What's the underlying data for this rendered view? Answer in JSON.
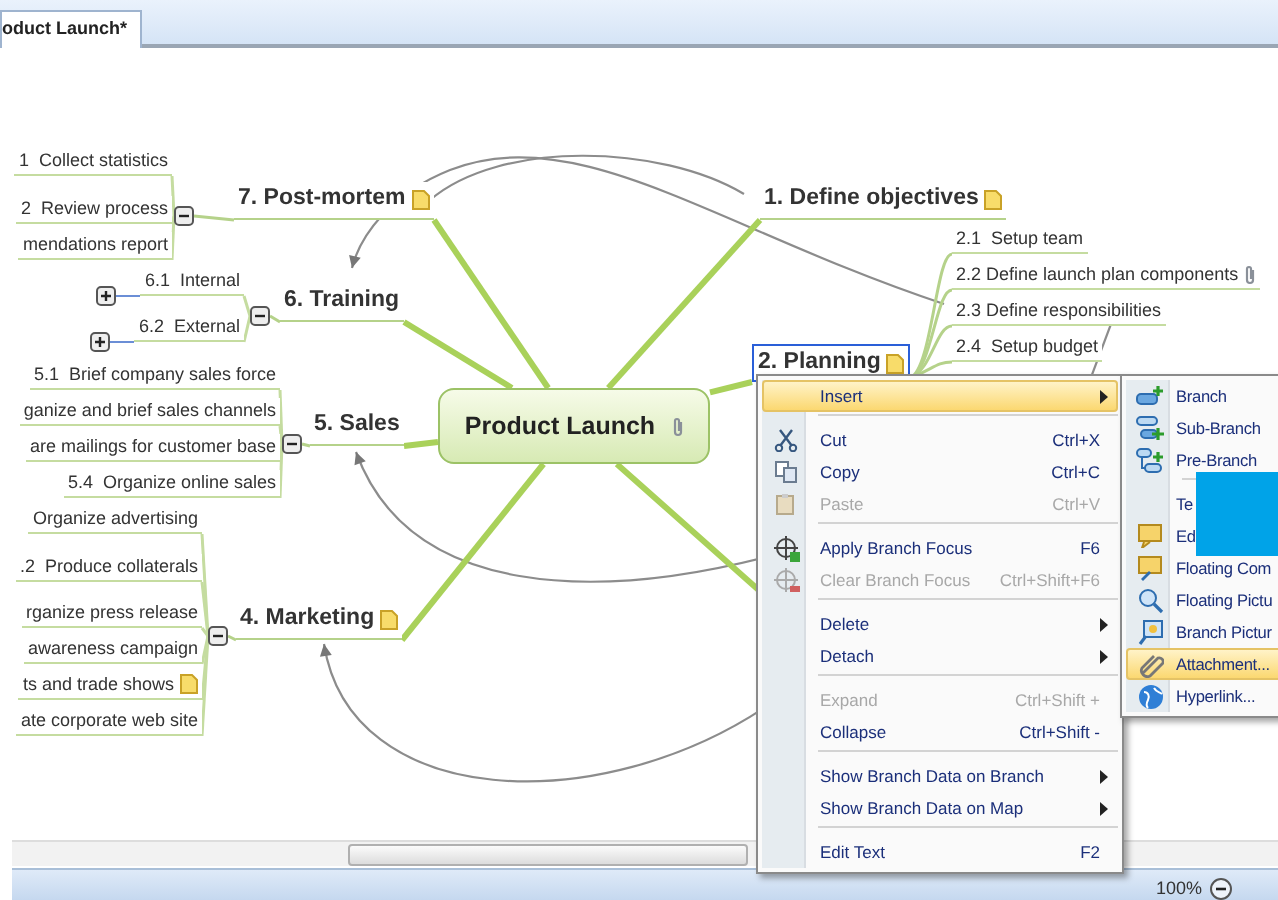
{
  "tab": {
    "label": "oduct Launch*"
  },
  "central_topic": {
    "label": "Product Launch",
    "attachment": true
  },
  "topics": [
    {
      "label": "7. Post-mortem",
      "note": true,
      "selected": false,
      "expanded": true,
      "subtopics": [
        {
          "label": "1  Collect statistics"
        },
        {
          "label": "2  Review process"
        },
        {
          "label": "mendations report"
        }
      ]
    },
    {
      "label": "1. Define objectives",
      "note": true,
      "selected": false
    },
    {
      "label": "6. Training",
      "selected": false,
      "expanded": true,
      "subtopics": [
        {
          "label": "6.1  Internal",
          "expanded": false
        },
        {
          "label": "6.2  External",
          "expanded": false
        }
      ]
    },
    {
      "label": "2. Planning",
      "note": true,
      "selected": true,
      "subtopics": [
        {
          "label": "2.1  Setup team"
        },
        {
          "label": "2.2 Define launch plan components",
          "attachment": true
        },
        {
          "label": "2.3 Define responsibilities"
        },
        {
          "label": "2.4  Setup budget"
        }
      ]
    },
    {
      "label": "5. Sales",
      "selected": false,
      "expanded": true,
      "subtopics": [
        {
          "label": "5.1  Brief company sales force"
        },
        {
          "label": "ganize and brief sales channels"
        },
        {
          "label": "are mailings for customer base"
        },
        {
          "label": "5.4  Organize online sales"
        }
      ]
    },
    {
      "label": "4. Marketing",
      "note": true,
      "selected": false,
      "expanded": true,
      "subtopics": [
        {
          "label": "Organize advertising"
        },
        {
          "label": ".2  Produce collaterals"
        },
        {
          "label": "rganize press release"
        },
        {
          "label": "awareness campaign"
        },
        {
          "label": "ts and trade shows",
          "note": true
        },
        {
          "label": "ate corporate web site"
        }
      ]
    }
  ],
  "context_menu": [
    {
      "kind": "item",
      "label": "Insert",
      "has_submenu": true,
      "selected": true,
      "disabled": false
    },
    {
      "kind": "separator"
    },
    {
      "kind": "item",
      "label": "Cut",
      "shortcut": "Ctrl+X",
      "selected": false,
      "disabled": false
    },
    {
      "kind": "item",
      "label": "Copy",
      "shortcut": "Ctrl+C",
      "selected": false,
      "disabled": false
    },
    {
      "kind": "item",
      "label": "Paste",
      "shortcut": "Ctrl+V",
      "selected": false,
      "disabled": true
    },
    {
      "kind": "separator"
    },
    {
      "kind": "item",
      "label": "Apply Branch Focus",
      "shortcut": "F6",
      "selected": false,
      "disabled": false
    },
    {
      "kind": "item",
      "label": "Clear Branch Focus",
      "shortcut": "Ctrl+Shift+F6",
      "selected": false,
      "disabled": true
    },
    {
      "kind": "separator"
    },
    {
      "kind": "item",
      "label": "Delete",
      "has_submenu": true,
      "selected": false,
      "disabled": false
    },
    {
      "kind": "item",
      "label": "Detach",
      "has_submenu": true,
      "selected": false,
      "disabled": false
    },
    {
      "kind": "separator"
    },
    {
      "kind": "item",
      "label": "Expand",
      "shortcut": "Ctrl+Shift +",
      "selected": false,
      "disabled": true
    },
    {
      "kind": "item",
      "label": "Collapse",
      "shortcut": "Ctrl+Shift -",
      "selected": false,
      "disabled": false
    },
    {
      "kind": "separator"
    },
    {
      "kind": "item",
      "label": "Show Branch Data on Branch",
      "has_submenu": true,
      "selected": false,
      "disabled": false
    },
    {
      "kind": "item",
      "label": "Show Branch Data on Map",
      "has_submenu": true,
      "selected": false,
      "disabled": false
    },
    {
      "kind": "separator"
    },
    {
      "kind": "item",
      "label": "Edit Text",
      "shortcut": "F2",
      "selected": false,
      "disabled": false
    }
  ],
  "insert_submenu": [
    {
      "kind": "item",
      "label": "Branch",
      "selected": false
    },
    {
      "kind": "item",
      "label": "Sub-Branch",
      "selected": false
    },
    {
      "kind": "item",
      "label": "Pre-Branch",
      "selected": false
    },
    {
      "kind": "separator"
    },
    {
      "kind": "item",
      "label": "Te",
      "selected": false
    },
    {
      "kind": "item",
      "label": "Ed",
      "selected": false
    },
    {
      "kind": "item",
      "label": "Floating Com",
      "selected": false
    },
    {
      "kind": "item",
      "label": "Floating Pictu",
      "selected": false
    },
    {
      "kind": "item",
      "label": "Branch Pictur",
      "selected": false
    },
    {
      "kind": "item",
      "label": "Attachment...",
      "selected": true
    },
    {
      "kind": "item",
      "label": "Hyperlink...",
      "selected": false
    }
  ],
  "status_bar": {
    "zoom": "100%"
  }
}
